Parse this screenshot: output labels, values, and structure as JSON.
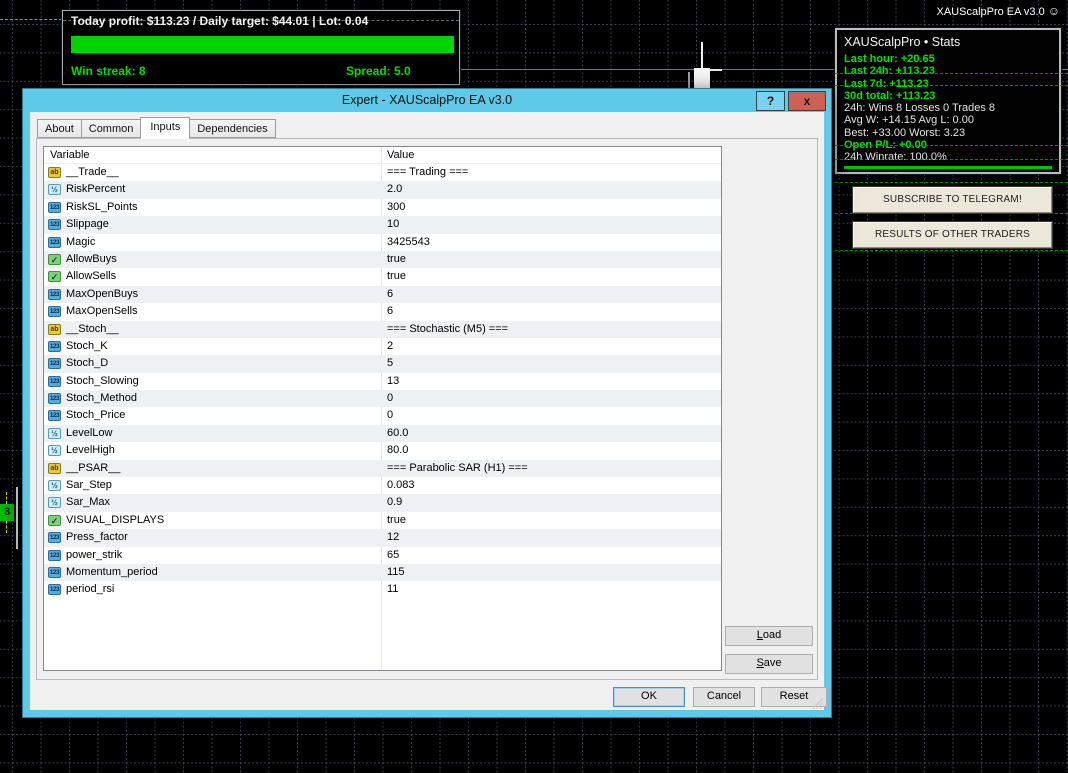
{
  "chart": {
    "ea_label": "XAUScalpPro EA v3.0",
    "smiley": "☺",
    "price_marker": "3"
  },
  "profit_panel": {
    "header": "Today profit: $113.23 / Daily target: $44.01 | Lot: 0.04",
    "win_streak": "Win streak: 8",
    "spread": "Spread: 5.0"
  },
  "stats_panel": {
    "title": "XAUScalpPro • Stats",
    "green_lines": [
      "Last hour: +20.65",
      "Last 24h: +113.23",
      "Last 7d: +113.23",
      "30d total: +113.23"
    ],
    "white_lines": [
      "24h: Wins 8 Losses 0 Trades 8",
      "Avg W: +14.15  Avg L: 0.00",
      "Best: +33.00  Worst: 3.23"
    ],
    "open_pl": "Open P/L: +0.00",
    "winrate": "24h Winrate: 100.0%"
  },
  "side_buttons": {
    "telegram": "SUBSCRIBE TO TELEGRAM!",
    "results": "RESULTS OF OTHER TRADERS"
  },
  "dialog": {
    "title": "Expert - XAUScalpPro EA v3.0",
    "help_label": "?",
    "close_label": "x",
    "tabs": [
      {
        "label": "About",
        "active": false
      },
      {
        "label": "Common",
        "active": false
      },
      {
        "label": "Inputs",
        "active": true
      },
      {
        "label": "Dependencies",
        "active": false
      }
    ],
    "columns": [
      "Variable",
      "Value"
    ],
    "icon_glyphs": {
      "str": "ab",
      "dbl": "½",
      "int": "123",
      "bool": "✓"
    },
    "rows": [
      {
        "type": "str",
        "name": "__Trade__",
        "value": "=== Trading ==="
      },
      {
        "type": "dbl",
        "name": "RiskPercent",
        "value": "2.0"
      },
      {
        "type": "int",
        "name": "RiskSL_Points",
        "value": "300"
      },
      {
        "type": "int",
        "name": "Slippage",
        "value": "10"
      },
      {
        "type": "int",
        "name": "Magic",
        "value": "3425543"
      },
      {
        "type": "bool",
        "name": "AllowBuys",
        "value": "true"
      },
      {
        "type": "bool",
        "name": "AllowSells",
        "value": "true"
      },
      {
        "type": "int",
        "name": "MaxOpenBuys",
        "value": "6"
      },
      {
        "type": "int",
        "name": "MaxOpenSells",
        "value": "6"
      },
      {
        "type": "str",
        "name": "__Stoch__",
        "value": "=== Stochastic (M5) ==="
      },
      {
        "type": "int",
        "name": "Stoch_K",
        "value": "2"
      },
      {
        "type": "int",
        "name": "Stoch_D",
        "value": "5"
      },
      {
        "type": "int",
        "name": "Stoch_Slowing",
        "value": "13"
      },
      {
        "type": "int",
        "name": "Stoch_Method",
        "value": "0"
      },
      {
        "type": "int",
        "name": "Stoch_Price",
        "value": "0"
      },
      {
        "type": "dbl",
        "name": "LevelLow",
        "value": "60.0"
      },
      {
        "type": "dbl",
        "name": "LevelHigh",
        "value": "80.0"
      },
      {
        "type": "str",
        "name": "__PSAR__",
        "value": "=== Parabolic SAR (H1) ==="
      },
      {
        "type": "dbl",
        "name": "Sar_Step",
        "value": "0.083"
      },
      {
        "type": "dbl",
        "name": "Sar_Max",
        "value": "0.9"
      },
      {
        "type": "bool",
        "name": "VISUAL_DISPLAYS",
        "value": "true"
      },
      {
        "type": "int",
        "name": "Press_factor",
        "value": "12"
      },
      {
        "type": "int",
        "name": "power_strik",
        "value": "65"
      },
      {
        "type": "int",
        "name": "Momentum_period",
        "value": "115"
      },
      {
        "type": "int",
        "name": "period_rsi",
        "value": "11"
      }
    ],
    "buttons": {
      "load": "Load",
      "save": "Save",
      "ok": "OK",
      "cancel": "Cancel",
      "reset": "Reset"
    }
  },
  "colors": {
    "profit_green": "#00e400",
    "bar_green": "#00d400",
    "titlebar_blue": "#5ec9e8",
    "close_red": "#cd6155",
    "grid_gray": "#39414d",
    "button_beige": "#ece8d9"
  }
}
